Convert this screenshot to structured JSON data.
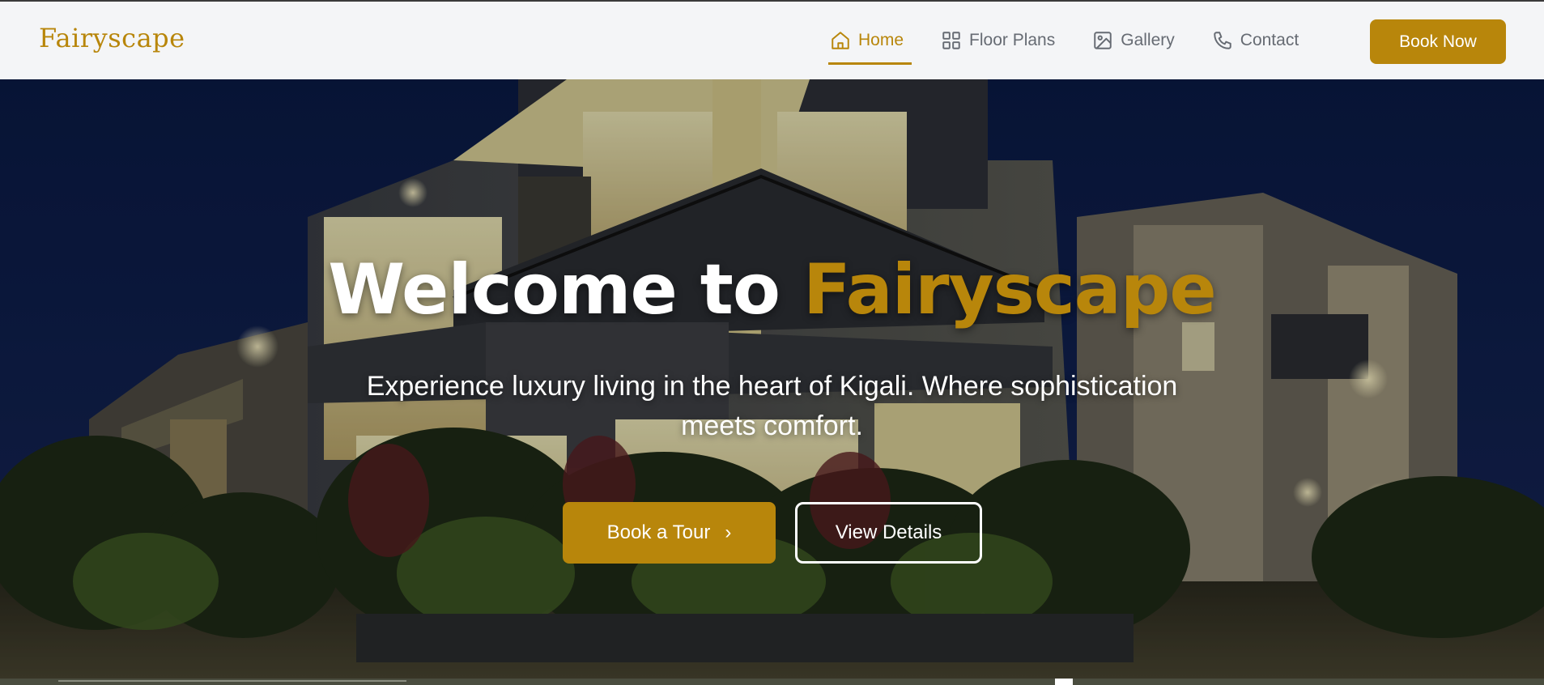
{
  "brand": {
    "name": "Fairyscape",
    "accent_color": "#b8860b"
  },
  "nav": {
    "items": [
      {
        "label": "Home",
        "icon": "home-icon",
        "active": true
      },
      {
        "label": "Floor Plans",
        "icon": "grid-icon",
        "active": false
      },
      {
        "label": "Gallery",
        "icon": "image-icon",
        "active": false
      },
      {
        "label": "Contact",
        "icon": "phone-icon",
        "active": false
      }
    ],
    "cta_label": "Book Now"
  },
  "hero": {
    "title_prefix": "Welcome to",
    "title_accent": "Fairyscape",
    "subtitle": "Experience luxury living in the heart of Kigali. Where sophistication meets comfort.",
    "primary_button": "Book a Tour",
    "primary_button_icon": "chevron-right-icon",
    "secondary_button": "View Details",
    "background_image": "modern-apartment-building-at-night"
  }
}
